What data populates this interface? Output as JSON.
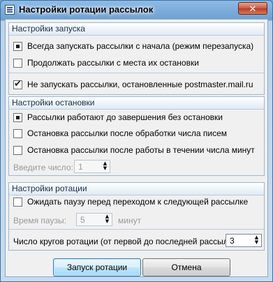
{
  "window": {
    "title": "Настройки ротации рассылок",
    "close_label": "✕"
  },
  "launch": {
    "header": "Настройки запуска",
    "always_restart": "Всегда запускать рассылки с начала (режим перезапуска)",
    "continue_from_stop": "Продолжать рассылки с места их остановки",
    "skip_postmaster": "Не запускать рассылки, остановленные postmaster.mail.ru"
  },
  "stop": {
    "header": "Настройки остановки",
    "run_until_done": "Рассылки работают до завершения без остановки",
    "stop_after_letters": "Остановка рассылки после обработки числа писем",
    "stop_after_minutes": "Остановка рассылки после работы в течении числа минут",
    "enter_number_label": "Введите число:",
    "enter_number_value": "1"
  },
  "rotation": {
    "header": "Настройки ротации",
    "wait_pause": "Ожидать паузу перед переходом к следующей рассылке",
    "pause_time_label": "Время паузы:",
    "pause_time_value": "5",
    "pause_unit": "минут",
    "rounds_label": "Число кругов ротации (от первой до последней рассылки):",
    "rounds_value": "3"
  },
  "buttons": {
    "start": "Запуск ротации",
    "cancel": "Отмена"
  },
  "icons": {
    "up": "▲",
    "down": "▼"
  }
}
